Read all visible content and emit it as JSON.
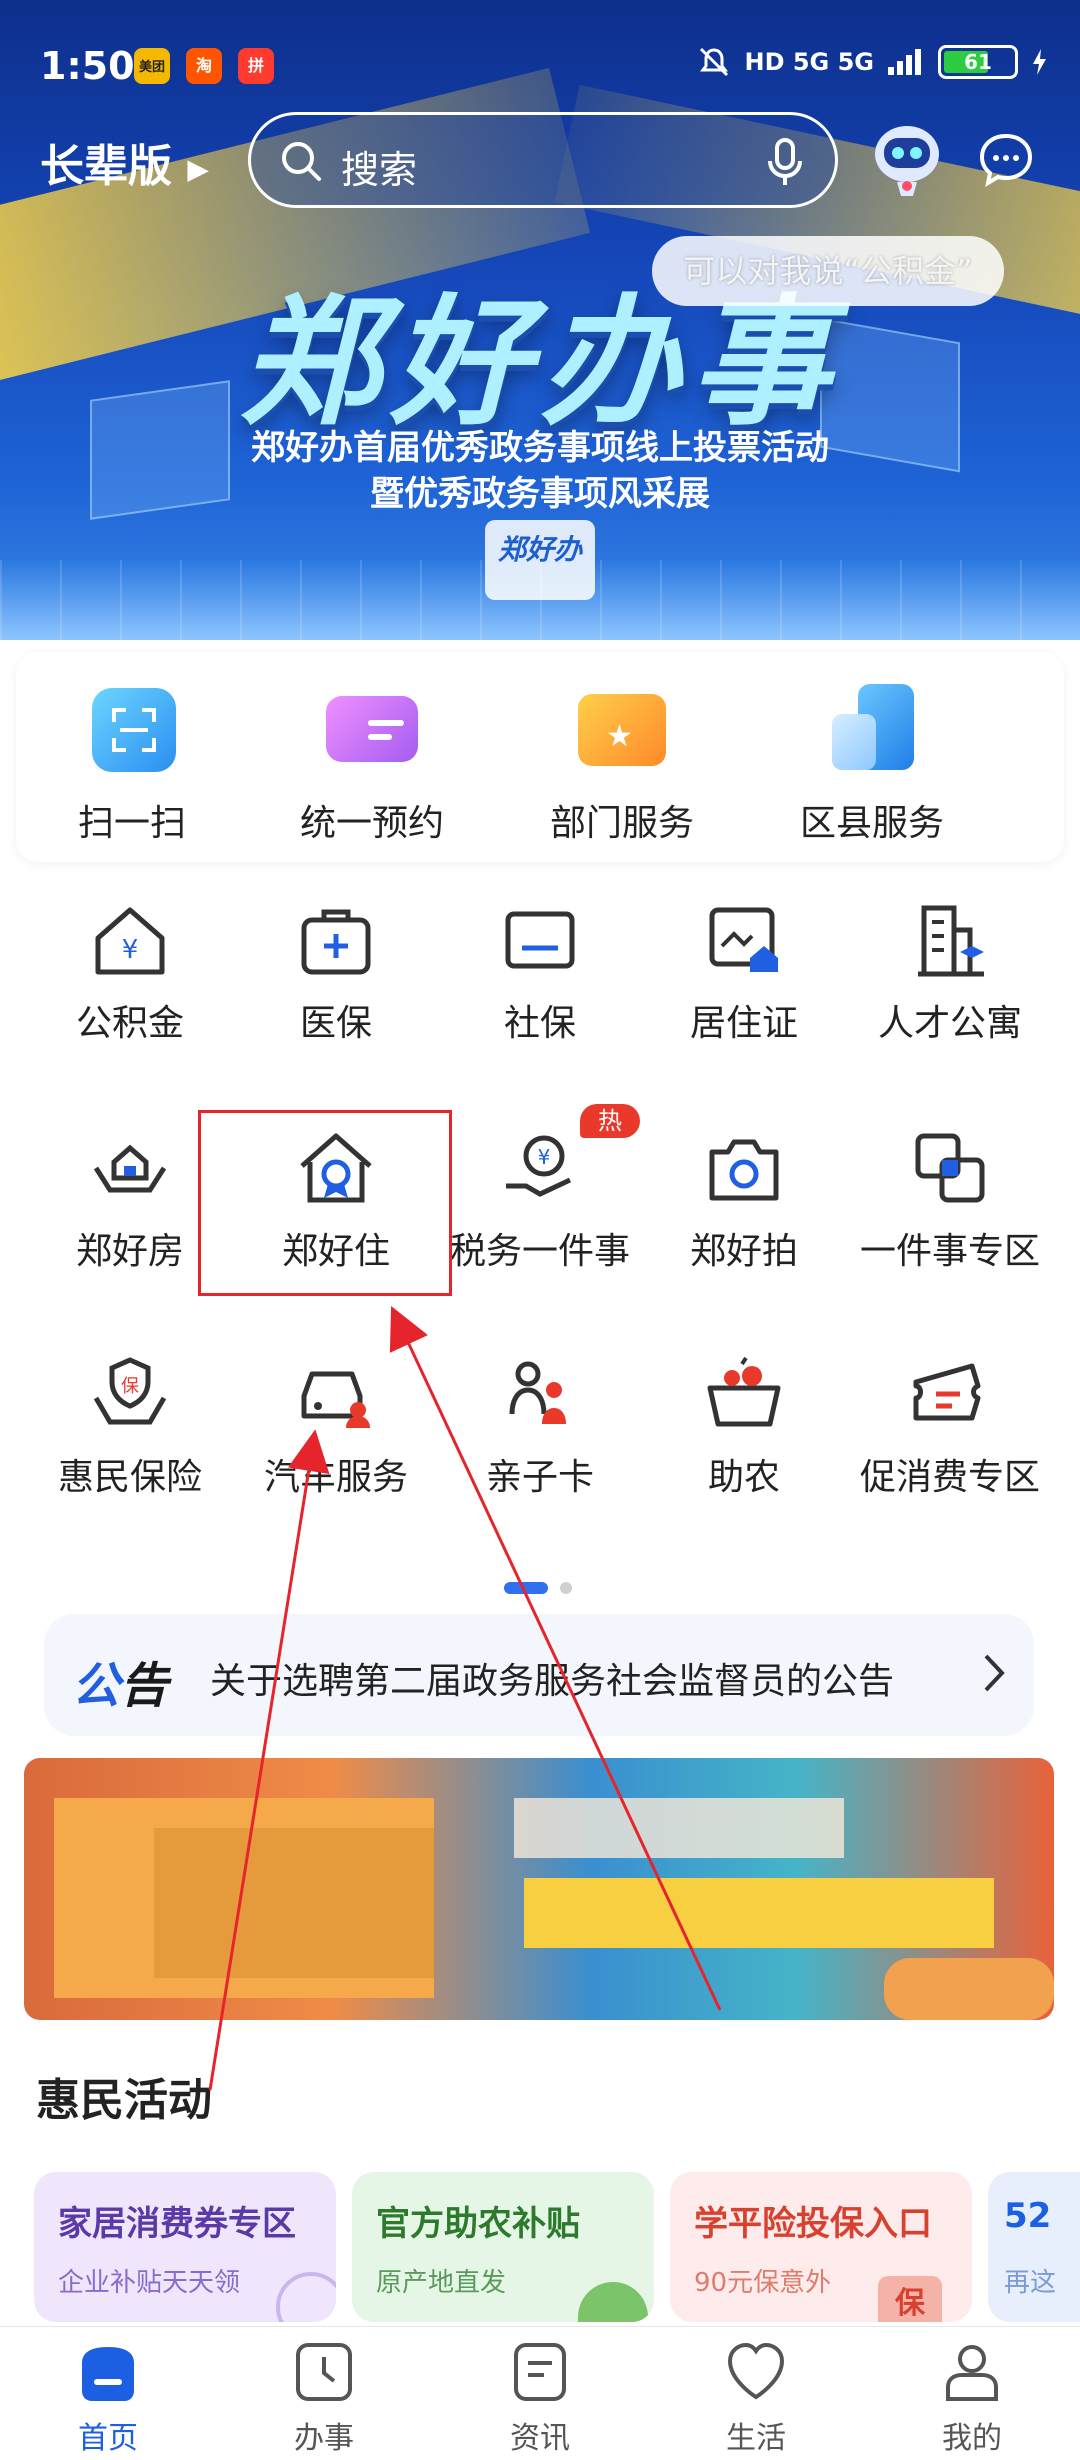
{
  "status": {
    "time": "1:50",
    "apps": [
      {
        "name": "美团",
        "color": "#f5b800"
      },
      {
        "name": "淘",
        "color": "#ff5500"
      },
      {
        "name": "拼",
        "color": "#ff3b30"
      }
    ],
    "network": "HD 5G 5G",
    "battery": "61"
  },
  "header": {
    "elder_mode": "长辈版",
    "search_placeholder": "搜索",
    "voice_tip": "可以对我说“公积金”"
  },
  "hero": {
    "title": "郑好办事",
    "subtitle_1": "郑好办首届优秀政务事项线上投票活动",
    "subtitle_2": "暨优秀政务事项风采展",
    "logo": "郑好办"
  },
  "quick_actions": [
    {
      "label": "扫一扫",
      "icon": "scan-icon"
    },
    {
      "label": "统一预约",
      "icon": "appointment-card-icon"
    },
    {
      "label": "部门服务",
      "icon": "department-folder-icon"
    },
    {
      "label": "区县服务",
      "icon": "district-building-icon"
    }
  ],
  "services": [
    {
      "label": "公积金",
      "icon": "house-yuan-icon"
    },
    {
      "label": "医保",
      "icon": "medical-kit-icon"
    },
    {
      "label": "社保",
      "icon": "card-icon"
    },
    {
      "label": "居住证",
      "icon": "residence-permit-icon"
    },
    {
      "label": "人才公寓",
      "icon": "talent-apartment-icon"
    },
    {
      "label": "郑好房",
      "icon": "hands-house-icon"
    },
    {
      "label": "郑好住",
      "icon": "house-medal-icon"
    },
    {
      "label": "税务一件事",
      "icon": "tax-hand-icon"
    },
    {
      "label": "郑好拍",
      "icon": "camera-icon"
    },
    {
      "label": "一件事专区",
      "icon": "overlap-squares-icon"
    },
    {
      "label": "惠民保险",
      "icon": "insurance-hands-icon"
    },
    {
      "label": "汽车服务",
      "icon": "car-service-icon"
    },
    {
      "label": "亲子卡",
      "icon": "parent-child-icon"
    },
    {
      "label": "助农",
      "icon": "farm-basket-icon"
    },
    {
      "label": "促消费专区",
      "icon": "coupon-icon"
    }
  ],
  "hot_badge": "热",
  "notice": {
    "tag_1": "公",
    "tag_2": "告",
    "text": "关于选聘第二届政务服务社会监督员的公告"
  },
  "section_title": "惠民活动",
  "activities": [
    {
      "title": "家居消费券专区",
      "subtitle": "企业补贴天天领",
      "bg": "#efe6fb",
      "color": "#5b3aa8"
    },
    {
      "title": "官方助农补贴",
      "subtitle": "原产地直发",
      "bg": "#e6f6e6",
      "color": "#2c7a2c"
    },
    {
      "title": "学平险投保入口",
      "subtitle": "90元保意外",
      "bg": "#fdeceb",
      "color": "#d8412f"
    },
    {
      "title": "52",
      "subtitle": "再这",
      "bg": "#e7effc",
      "color": "#1d5fe2"
    }
  ],
  "tabs": [
    {
      "label": "首页",
      "icon": "home-icon",
      "active": true
    },
    {
      "label": "办事",
      "icon": "clock-icon",
      "active": false
    },
    {
      "label": "资讯",
      "icon": "news-icon",
      "active": false
    },
    {
      "label": "生活",
      "icon": "heart-icon",
      "active": false
    },
    {
      "label": "我的",
      "icon": "profile-icon",
      "active": false
    }
  ]
}
